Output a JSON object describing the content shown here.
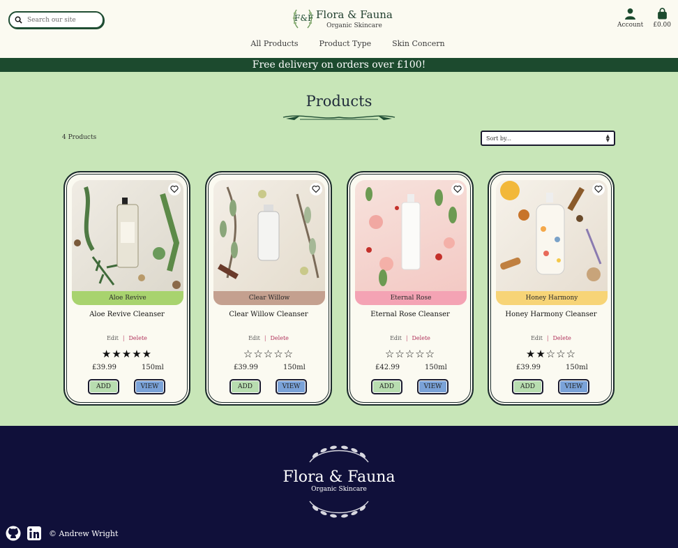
{
  "header": {
    "search_placeholder": "Search our site",
    "brand_monogram": "F&F",
    "brand_name": "Flora & Fauna",
    "brand_subtitle": "Organic Skincare",
    "account_label": "Account",
    "cart_total": "£0.00"
  },
  "nav": {
    "items": [
      "All Products",
      "Product Type",
      "Skin Concern"
    ]
  },
  "banner": "Free delivery on orders over £100!",
  "main": {
    "title": "Products",
    "count": "4 Products",
    "sort_value": "Sort by..."
  },
  "products": [
    {
      "tag": "Aloe Revive",
      "name": "Aloe Revive Cleanser",
      "edit": "Edit",
      "delete": "Delete",
      "rating": 5,
      "price": "£39.99",
      "size": "150ml",
      "add": "ADD",
      "view": "VIEW",
      "tag_color": "#a8d36e"
    },
    {
      "tag": "Clear Willow",
      "name": "Clear Willow Cleanser",
      "edit": "Edit",
      "delete": "Delete",
      "rating": 0,
      "price": "£39.99",
      "size": "150ml",
      "add": "ADD",
      "view": "VIEW",
      "tag_color": "#c4a08f"
    },
    {
      "tag": "Eternal Rose",
      "name": "Eternal Rose Cleanser",
      "edit": "Edit",
      "delete": "Delete",
      "rating": 0,
      "price": "£42.99",
      "size": "150ml",
      "add": "ADD",
      "view": "VIEW",
      "tag_color": "#f4a3b4"
    },
    {
      "tag": "Honey Harmony",
      "name": "Honey Harmony Cleanser",
      "edit": "Edit",
      "delete": "Delete",
      "rating": 2,
      "price": "£39.99",
      "size": "150ml",
      "add": "ADD",
      "view": "VIEW",
      "tag_color": "#f7d477"
    }
  ],
  "footer": {
    "brand_name": "Flora & Fauna",
    "brand_subtitle": "Organic Skincare",
    "copyright": "© Andrew Wright"
  },
  "colors": {
    "page_bg": "#c8e6b8",
    "header_bg": "#fbfaf1",
    "banner_bg": "#1c4a2e",
    "footer_bg": "#10103a",
    "add_button": "#b8ddb0",
    "view_button": "#7aa2d8"
  }
}
